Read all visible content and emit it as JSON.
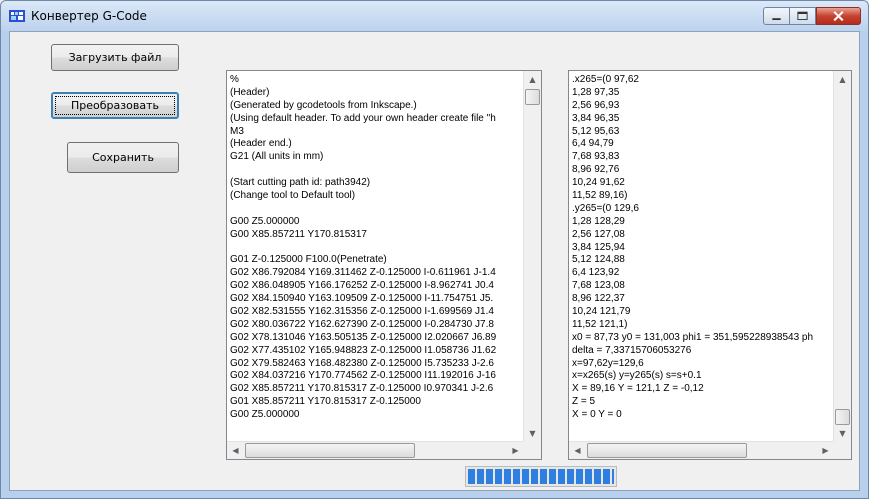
{
  "window": {
    "title": "Конвертер G-Code",
    "icon": "app-icon",
    "controls": [
      "minimize-icon",
      "maximize-icon",
      "close-icon"
    ]
  },
  "buttons": {
    "load": "Загрузить файл",
    "convert": "Преобразовать",
    "save": "Сохранить"
  },
  "gcode_pane": {
    "lines": [
      "%",
      "(Header)",
      "(Generated by gcodetools from Inkscape.)",
      "(Using default header. To add your own header create file \"h",
      "M3",
      "(Header end.)",
      "G21 (All units in mm)",
      "",
      "(Start cutting path id: path3942)",
      "(Change tool to Default tool)",
      "",
      "G00 Z5.000000",
      "G00 X85.857211 Y170.815317",
      "",
      "G01 Z-0.125000 F100.0(Penetrate)",
      "G02 X86.792084 Y169.311462 Z-0.125000 I-0.611961 J-1.4",
      "G02 X86.048905 Y166.176252 Z-0.125000 I-8.962741 J0.4",
      "G02 X84.150940 Y163.109509 Z-0.125000 I-11.754751 J5.",
      "G02 X82.531555 Y162.315356 Z-0.125000 I-1.699569 J1.4",
      "G02 X80.036722 Y162.627390 Z-0.125000 I-0.284730 J7.8",
      "G02 X78.131046 Y163.505135 Z-0.125000 I2.020667 J6.89",
      "G02 X77.435102 Y165.948823 Z-0.125000 I1.058736 J1.62",
      "G02 X79.582463 Y168.482380 Z-0.125000 I5.735233 J-2.6",
      "G02 X84.037216 Y170.774562 Z-0.125000 I11.192016 J-16",
      "G02 X85.857211 Y170.815317 Z-0.125000 I0.970341 J-2.6",
      "G01 X85.857211 Y170.815317 Z-0.125000",
      "G00 Z5.000000"
    ]
  },
  "output_pane": {
    "lines": [
      ".x265=(0 97,62",
      "1,28 97,35",
      "2,56 96,93",
      "3,84 96,35",
      "5,12 95,63",
      "6,4 94,79",
      "7,68 93,83",
      "8,96 92,76",
      "10,24 91,62",
      "11,52 89,16)",
      ".y265=(0 129,6",
      "1,28 128,29",
      "2,56 127,08",
      "3,84 125,94",
      "5,12 124,88",
      "6,4 123,92",
      "7,68 123,08",
      "8,96 122,37",
      "10,24 121,79",
      "11,52 121,1)",
      "x0 = 87,73 y0 = 131,003 phi1 = 351,595228938543 ph",
      "delta = 7,33715706053276",
      "x=97,62y=129,6",
      "x=x265(s) y=y265(s) s=s+0.1",
      "X = 89,16 Y = 121,1 Z = -0,12",
      "Z = 5",
      "X = 0 Y = 0"
    ]
  },
  "progress": {
    "blocks_filled": 16,
    "fraction": 1.0
  }
}
